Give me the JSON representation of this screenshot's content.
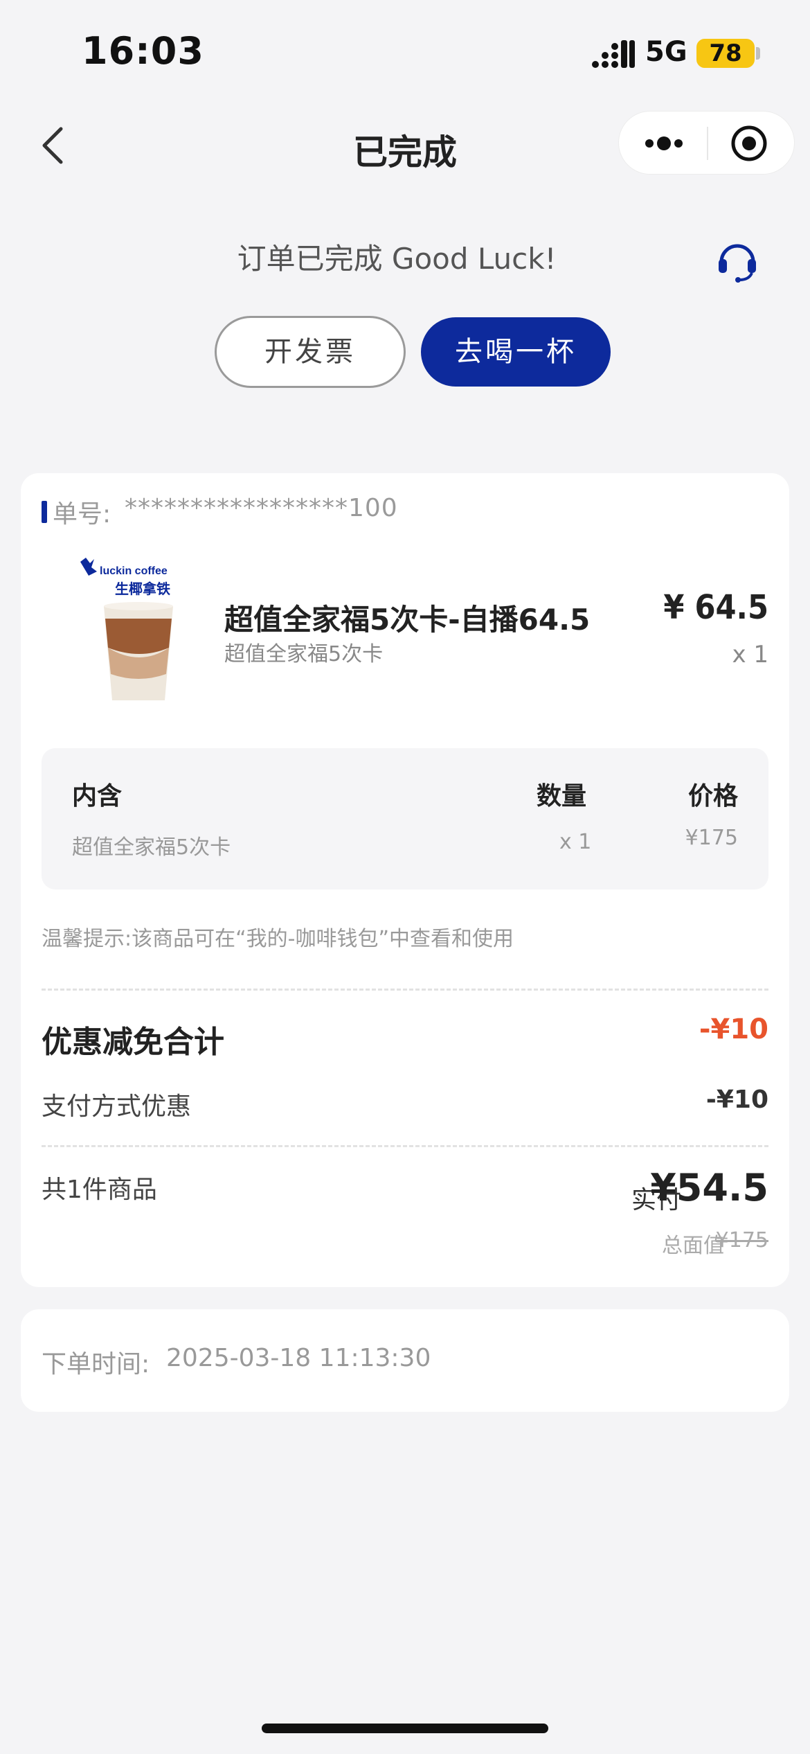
{
  "status_bar": {
    "time": "16:03",
    "network": "5G",
    "battery": "78"
  },
  "nav": {
    "title": "已完成",
    "back_icon": "chevron-left-icon",
    "more_icon": "more-dots-icon",
    "close_icon": "target-close-icon"
  },
  "header": {
    "status_text": "订单已完成 Good Luck!",
    "service_icon": "headset-icon",
    "invoice_button": "开发票",
    "drink_button": "去喝一杯"
  },
  "order": {
    "number_label": "单号:",
    "number": "*****************100",
    "product": {
      "logo_text": "luckin coffee",
      "image_caption": "生椰拿铁",
      "name": "超值全家福5次卡-自播64.5",
      "subtitle": "超值全家福5次卡",
      "price": "¥ 64.5",
      "quantity": "x 1"
    },
    "contents": {
      "headers": [
        "内含",
        "数量",
        "价格"
      ],
      "rows": [
        [
          "超值全家福5次卡",
          "x 1",
          "¥175"
        ]
      ]
    },
    "tip": "温馨提示:该商品可在“我的-咖啡钱包”中查看和使用",
    "discount_total_label": "优惠减免合计",
    "discount_total": "-¥10",
    "payment_discount_label": "支付方式优惠",
    "payment_discount": "-¥10",
    "item_count": "共1件商品",
    "paid_label": "实付",
    "paid_amount": "¥54.5",
    "face_value_label": "总面值",
    "face_value": "¥175"
  },
  "order_time": {
    "label": "下单时间:",
    "value": "2025-03-18 11:13:30"
  },
  "colors": {
    "brand_blue": "#0d2a9c",
    "discount_red": "#e8542c",
    "battery_yellow": "#f7c613",
    "background": "#f4f4f6"
  }
}
